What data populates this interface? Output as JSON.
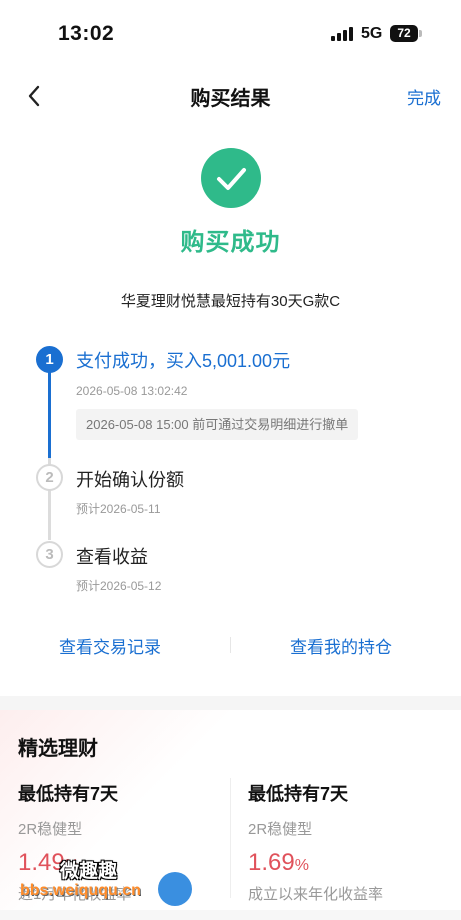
{
  "status_bar": {
    "time": "13:02",
    "network": "5G",
    "battery": "72"
  },
  "nav": {
    "title": "购买结果",
    "done": "完成"
  },
  "success": {
    "title": "购买成功",
    "product": "华夏理财悦慧最短持有30天G款C"
  },
  "steps": [
    {
      "num": "1",
      "title": "支付成功，买入5,001.00元",
      "sub": "2026-05-08 13:02:42",
      "note": "2026-05-08 15:00 前可通过交易明细进行撤单"
    },
    {
      "num": "2",
      "title": "开始确认份额",
      "sub": "预计2026-05-11"
    },
    {
      "num": "3",
      "title": "查看收益",
      "sub": "预计2026-05-12"
    }
  ],
  "actions": {
    "records": "查看交易记录",
    "holdings": "查看我的持仓"
  },
  "recommended": {
    "title": "精选理财",
    "items": [
      {
        "name": "最低持有7天",
        "risk": "2R稳健型",
        "rate": "1.49",
        "unit": "%",
        "desc": "近1月年化收益率"
      },
      {
        "name": "最低持有7天",
        "risk": "2R稳健型",
        "rate": "1.69",
        "unit": "%",
        "desc": "成立以来年化收益率"
      }
    ]
  },
  "watermark": {
    "top": "微趣趣",
    "bottom": "bbs.weiququ.cn"
  },
  "colors": {
    "accent": "#1a6fd1",
    "success": "#2fba8a",
    "rate": "#e0525b"
  }
}
